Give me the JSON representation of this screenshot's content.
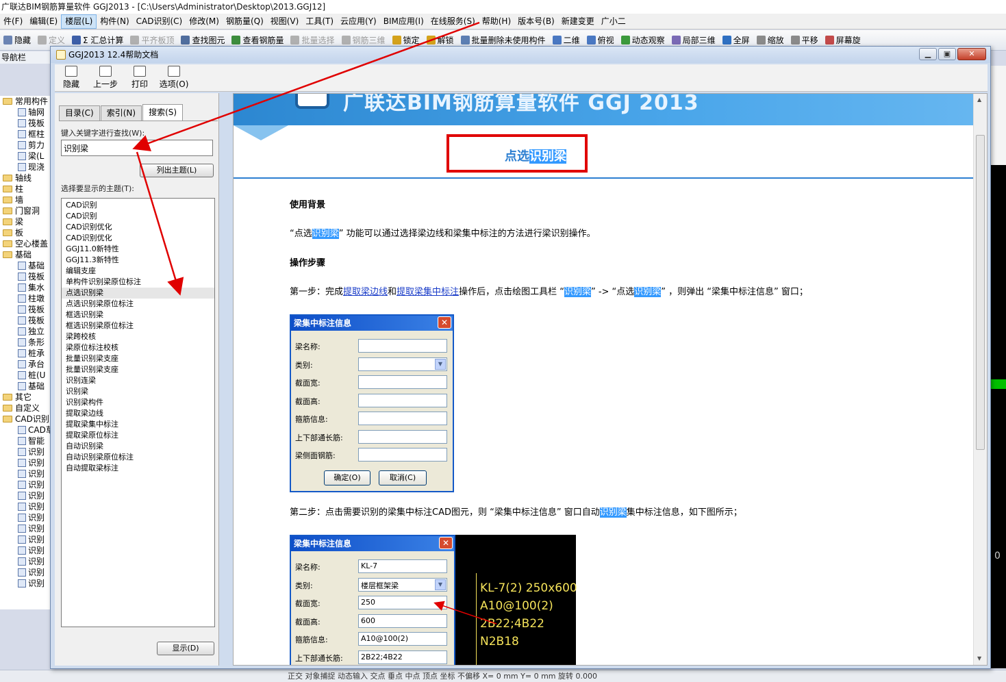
{
  "app": {
    "title": "广联达BIM钢筋算量软件 GGJ2013 - [C:\\Users\\Administrator\\Desktop\\2013.GGJ12]",
    "menu": [
      "件(F)",
      "编辑(E)",
      "楼层(L)",
      "构件(N)",
      "CAD识别(C)",
      "修改(M)",
      "钢筋量(Q)",
      "视图(V)",
      "工具(T)",
      "云应用(Y)",
      "BIM应用(I)",
      "在线服务(S)",
      "帮助(H)",
      "版本号(B)",
      "新建变更",
      "广小二"
    ],
    "toolbar": [
      "隐藏",
      "定义",
      "Σ 汇总计算",
      "平齐板顶",
      "查找图元",
      "查看钢筋量",
      "批量选择",
      "钢筋三维",
      "锁定",
      "解锁",
      "批量删除未使用构件",
      "二维",
      "俯视",
      "动态观察",
      "局部三维",
      "全屏",
      "缩放",
      "平移",
      "屏幕旋"
    ],
    "nav_label": "导航栏",
    "tree": [
      {
        "label": "常用构件",
        "kind": "folder"
      },
      {
        "label": "轴网",
        "kind": "node"
      },
      {
        "label": "筏板",
        "kind": "node"
      },
      {
        "label": "框柱",
        "kind": "node"
      },
      {
        "label": "剪力",
        "kind": "node"
      },
      {
        "label": "梁(L",
        "kind": "node"
      },
      {
        "label": "现浇",
        "kind": "node"
      },
      {
        "label": "轴线",
        "kind": "folder"
      },
      {
        "label": "柱",
        "kind": "folder"
      },
      {
        "label": "墙",
        "kind": "folder"
      },
      {
        "label": "门窗洞",
        "kind": "folder"
      },
      {
        "label": "梁",
        "kind": "folder"
      },
      {
        "label": "板",
        "kind": "folder"
      },
      {
        "label": "空心楼盖",
        "kind": "folder"
      },
      {
        "label": "基础",
        "kind": "folder"
      },
      {
        "label": "基础",
        "kind": "node"
      },
      {
        "label": "筏板",
        "kind": "node"
      },
      {
        "label": "集水",
        "kind": "node"
      },
      {
        "label": "柱墩",
        "kind": "node"
      },
      {
        "label": "筏板",
        "kind": "node"
      },
      {
        "label": "筏板",
        "kind": "node"
      },
      {
        "label": "独立",
        "kind": "node"
      },
      {
        "label": "条形",
        "kind": "node"
      },
      {
        "label": "桩承",
        "kind": "node"
      },
      {
        "label": "承台",
        "kind": "node"
      },
      {
        "label": "桩(U",
        "kind": "node"
      },
      {
        "label": "基础",
        "kind": "node"
      },
      {
        "label": "其它",
        "kind": "folder"
      },
      {
        "label": "自定义",
        "kind": "folder"
      },
      {
        "label": "CAD识别",
        "kind": "folder"
      },
      {
        "label": "CAD草",
        "kind": "node"
      },
      {
        "label": "智能",
        "kind": "node"
      },
      {
        "label": "识别",
        "kind": "node"
      },
      {
        "label": "识别",
        "kind": "node"
      },
      {
        "label": "识别",
        "kind": "node"
      },
      {
        "label": "识别",
        "kind": "node"
      },
      {
        "label": "识别",
        "kind": "node"
      },
      {
        "label": "识别",
        "kind": "node"
      },
      {
        "label": "识别",
        "kind": "node"
      },
      {
        "label": "识别",
        "kind": "node"
      },
      {
        "label": "识别",
        "kind": "node"
      },
      {
        "label": "识别",
        "kind": "node"
      },
      {
        "label": "识别",
        "kind": "node"
      },
      {
        "label": "识别",
        "kind": "node"
      },
      {
        "label": "识别",
        "kind": "node"
      }
    ],
    "status": "正交  对象捕捉  动态输入  交点  垂点  中点  顶点  坐标  不偏移  X= 0  mm Y= 0  mm  旋转  0.000",
    "right_strip_value": "0"
  },
  "help": {
    "title": "GGJ2013 12.4帮助文档",
    "toolbar": [
      {
        "label": "隐藏",
        "icon": "hide-icon"
      },
      {
        "label": "上一步",
        "icon": "back-arrow-icon"
      },
      {
        "label": "打印",
        "icon": "printer-icon"
      },
      {
        "label": "选项(O)",
        "icon": "options-icon"
      }
    ],
    "tabs": [
      "目录(C)",
      "索引(N)",
      "搜索(S)"
    ],
    "active_tab": 2,
    "keyword_label": "键入关键字进行查找(W):",
    "keyword_value": "识别梁",
    "list_topics_button": "列出主题(L)",
    "select_topic_label": "选择要显示的主题(T):",
    "topics": [
      "CAD识别",
      "CAD识别",
      "CAD识别优化",
      "CAD识别优化",
      "GGJ11.0新特性",
      "GGJ11.3新特性",
      "编辑支座",
      "单构件识别梁原位标注",
      "点选识别梁",
      "点选识别梁原位标注",
      "框选识别梁",
      "框选识别梁原位标注",
      "梁跨校核",
      "梁原位标注校核",
      "批量识别梁支座",
      "批量识别梁支座",
      "识别连梁",
      "识别梁",
      "识别梁构件",
      "提取梁边线",
      "提取梁集中标注",
      "提取梁原位标注",
      "自动识别梁",
      "自动识别梁原位标注",
      "自动提取梁标注"
    ],
    "selected_topic": 8,
    "display_button": "显示(D)",
    "content": {
      "banner_text": "广联达BIM钢筋算量软件 GGJ 2013",
      "title_prefix": "点选",
      "title_highlight": "识别梁",
      "h_background": "使用背景",
      "p1": [
        "“点选",
        "识别梁",
        "” 功能可以通过选择梁边线和梁集中标注的方法进行梁识别操作。"
      ],
      "h_steps": "操作步骤",
      "p2": [
        "第一步：完成",
        "提取梁边线",
        "和",
        "提取梁集中标注",
        "操作后，点击绘图工具栏 “",
        "识别梁",
        "” -> “点选",
        "识别梁",
        "” ，则弹出 “梁集中标注信息” 窗口；"
      ],
      "p3": [
        "第二步：点击需要识别的梁集中标注CAD图元，则 “梁集中标注信息” 窗口自动",
        "识别梁",
        "集中标注信息，如下图所示；"
      ]
    },
    "dialog1": {
      "title": "梁集中标注信息",
      "fields": [
        "梁名称:",
        "类别:",
        "截面宽:",
        "截面高:",
        "箍筋信息:",
        "上下部通长筋:",
        "梁侧面钢筋:"
      ],
      "ok": "确定(O)",
      "cancel": "取消(C)"
    },
    "dialog2": {
      "title": "梁集中标注信息",
      "fields": [
        {
          "label": "梁名称:",
          "value": "KL-7"
        },
        {
          "label": "类别:",
          "value": "楼层框架梁"
        },
        {
          "label": "截面宽:",
          "value": "250"
        },
        {
          "label": "截面高:",
          "value": "600"
        },
        {
          "label": "箍筋信息:",
          "value": "A10@100(2)"
        },
        {
          "label": "上下部通长筋:",
          "value": "2B22;4B22"
        }
      ],
      "cad_lines": [
        "KL-7(2) 250x600",
        "A10@100(2)",
        "2B22;4B22",
        "N2B18"
      ]
    }
  },
  "colors": {
    "annotation_red": "#e00000",
    "highlight_blue": "#3399ff",
    "title_blue": "#2d7fd1",
    "link_blue": "#1a3cc8",
    "cad_yellow": "#f5e35a",
    "dialog_title_blue": "#0e4ec8"
  }
}
